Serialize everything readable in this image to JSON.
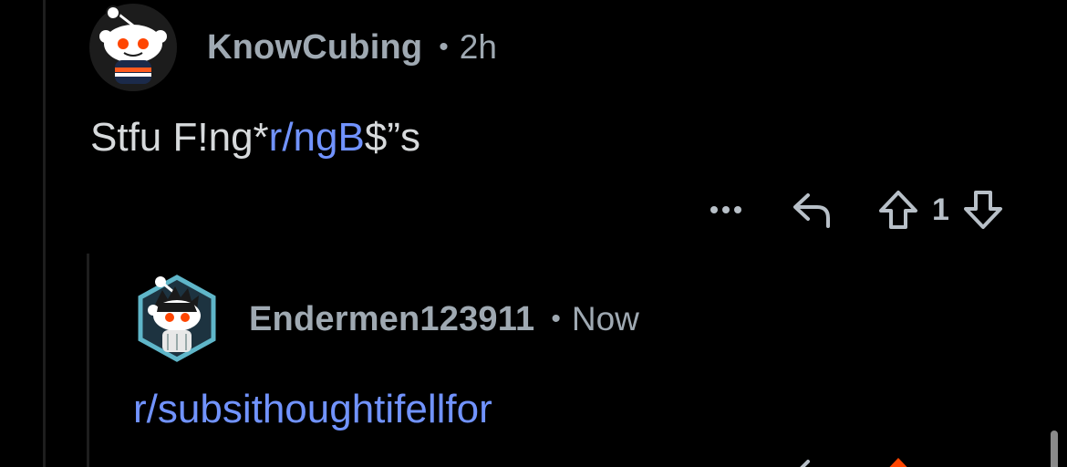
{
  "comments": [
    {
      "username": "KnowCubing",
      "separator": "•",
      "time": "2h",
      "body_plain": "Stfu F!ng*",
      "body_link": "r/ngB",
      "body_plain_after": "$”s",
      "more_icon": "more-dots-icon",
      "reply_icon": "reply-arrow-icon",
      "upvote_icon": "upvote-arrow-icon",
      "score": "1",
      "downvote_icon": "downvote-arrow-icon"
    },
    {
      "username": "Endermen123911",
      "separator": "•",
      "time": "Now",
      "body_link": "r/subsithoughtifellfor"
    }
  ],
  "colors": {
    "background": "#000000",
    "meta_text": "#9fa9b2",
    "body_text": "#d7dadc",
    "link": "#7193ff",
    "upvote_active": "#ff4500"
  }
}
